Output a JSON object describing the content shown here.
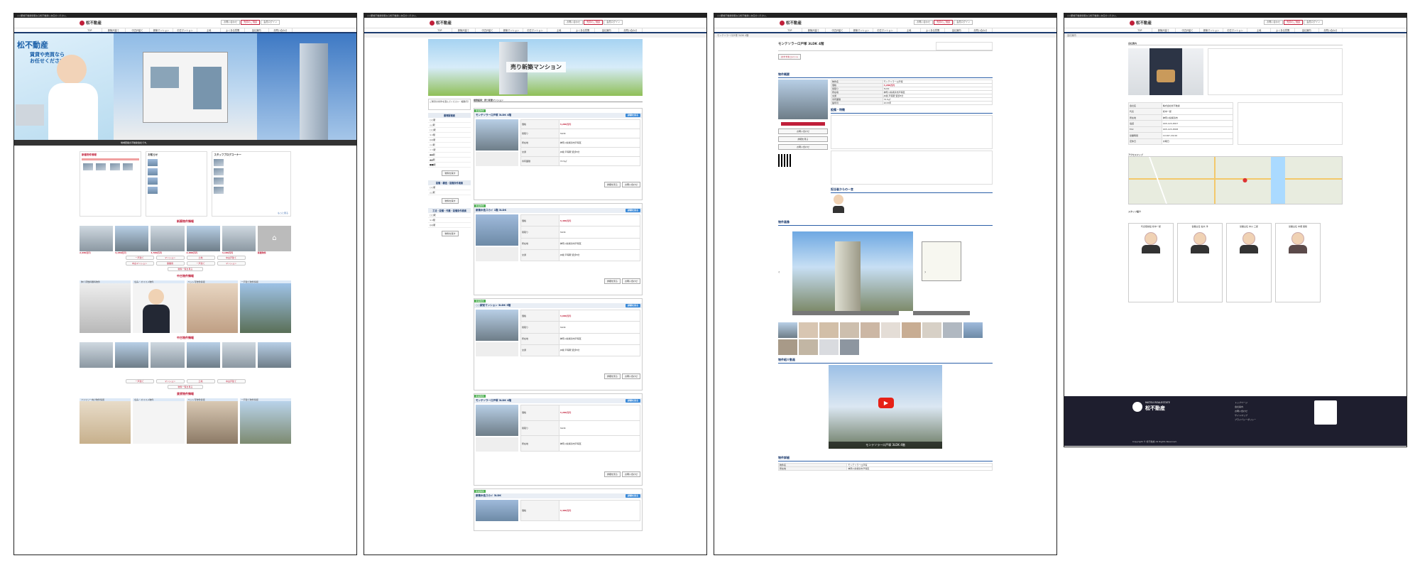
{
  "site": {
    "notice": "○○駅前不動産情報なら松不動産にお任せください。",
    "logo": "松不動産",
    "btn_contact": "お問い合わせ",
    "btn_sell": "売却のご相談",
    "btn_member": "会員ログイン",
    "nav": [
      "TOP",
      "新築戸建て",
      "中古戸建て",
      "新築マンション",
      "中古マンション",
      "土地",
      "よくある質問",
      "会社案内",
      "お問い合わせ"
    ]
  },
  "p1": {
    "hero_title": "松不動産",
    "hero_sub": "賃貸や売買なら\nお任せください",
    "hero_caption": "地域密着の不動産会社です。",
    "news_title": "新着物件情報",
    "info_title": "お知らせ",
    "staff_title": "スタッフブログコーナー",
    "more": "もっと見る",
    "sec_new": "新築物件情報",
    "sec_used": "中古物件情報",
    "sec_used2": "中古物件情報",
    "sec_rent": "賃貸物件情報",
    "more_btn": "物件一覧を見る",
    "cat1": [
      "仲介手数料無料物件",
      "住み・オススメ物件",
      "ペット可物件情報",
      "一戸建て物件情報"
    ],
    "cat2": [
      "ファミリー向け物件情報",
      "住み・オススメ物件",
      "ペット可物件情報",
      "一戸建て物件情報"
    ],
    "cards_new": [
      "2,980万円",
      "3,280万円",
      "3,580万円",
      "2,880万円",
      "4,180万円",
      "新着物件"
    ],
    "pill_labels": [
      "一戸建て",
      "マンション",
      "土地",
      "中古戸建て",
      "中古マンション",
      "事業用"
    ]
  },
  "p2": {
    "banner": "売り新築マンション",
    "side_title1": "ご希望の条件を選んでください（複数可）",
    "side_h1": "最寄駅検索",
    "side_items1": [
      "○○駅",
      "△△駅",
      "□□駅",
      "××駅",
      "◎◎駅",
      "◇◇駅",
      "☆☆駅",
      "◆◆駅",
      "▲▲駅",
      "■■駅"
    ],
    "side_btn": "物件を探す",
    "side_h2": "設備・構造・設備条件検索",
    "side_h3": "工法・設備・作業・設備条件検索",
    "list_title": "検索結果：売り新築マンション",
    "listings": [
      {
        "name": "モンテソラーロ戸塚 3LDK 4階",
        "price": "3,280万円"
      },
      {
        "name": "新築木造スカイ 1階 3LDK",
        "price": "3,480万円"
      },
      {
        "name": "○○駅前マンション 3LDK 5階",
        "price": "3,680万円"
      },
      {
        "name": "モンテソラーロ戸塚 3LDK 4階",
        "price": "3,280万円"
      },
      {
        "name": "新築木造スカイ 3LDK",
        "price": "3,480万円"
      }
    ],
    "tag": "新着物件",
    "detail_btn": "詳細を見る",
    "contact_btn": "お問い合わせ"
  },
  "p3": {
    "title": "モンテソラーロ戸塚 3LDK 4階",
    "comment_btn": "おすすめコメント",
    "sec_outline": "物件概要",
    "sec_equip": "設備・特徴",
    "sec_staff": "担当者からの一言",
    "sec_photos": "物件画像",
    "sec_video": "物件紹介動画",
    "video_caption": "モンテソラーロ戸塚 3LDK 4階",
    "sec_detail": "物件詳細",
    "price": "3,280万円",
    "rows": [
      [
        "物件名",
        "モンテソラーロ戸塚"
      ],
      [
        "価格",
        "3,280万円"
      ],
      [
        "間取り",
        "3LDK"
      ],
      [
        "所在地",
        "神奈川県横浜市戸塚区"
      ],
      [
        "交通",
        "JR線 戸塚駅 徒歩8分"
      ],
      [
        "専有面積",
        "72.5㎡"
      ],
      [
        "築年月",
        "2015年"
      ]
    ]
  },
  "p4": {
    "company_title": "会社案内",
    "access_title": "アクセスマップ",
    "staff_title": "スタッフ紹介",
    "staff": [
      "代表取締役 松中一郎",
      "営業主任 佐木 洋",
      "営業主任 中川 三郎",
      "営業主任 中畑 美穂"
    ],
    "company_rows": [
      [
        "会社名",
        "株式会社松不動産"
      ],
      [
        "代表",
        "松中一郎"
      ],
      [
        "所在地",
        "神奈川県横浜市"
      ],
      [
        "電話",
        "045-123-4567"
      ],
      [
        "FAX",
        "045-123-4568"
      ],
      [
        "営業時間",
        "10:00〜19:00"
      ],
      [
        "定休日",
        "水曜日"
      ]
    ],
    "footer_en": "MATSU REALESTATE",
    "footer_name": "松不動産",
    "footer_links": [
      "トップページ",
      "会社案内",
      "お問い合わせ",
      "サイトマップ",
      "プライバシーポリシー"
    ],
    "copyright": "Copyright © 松不動産 All Rights Reserved."
  }
}
